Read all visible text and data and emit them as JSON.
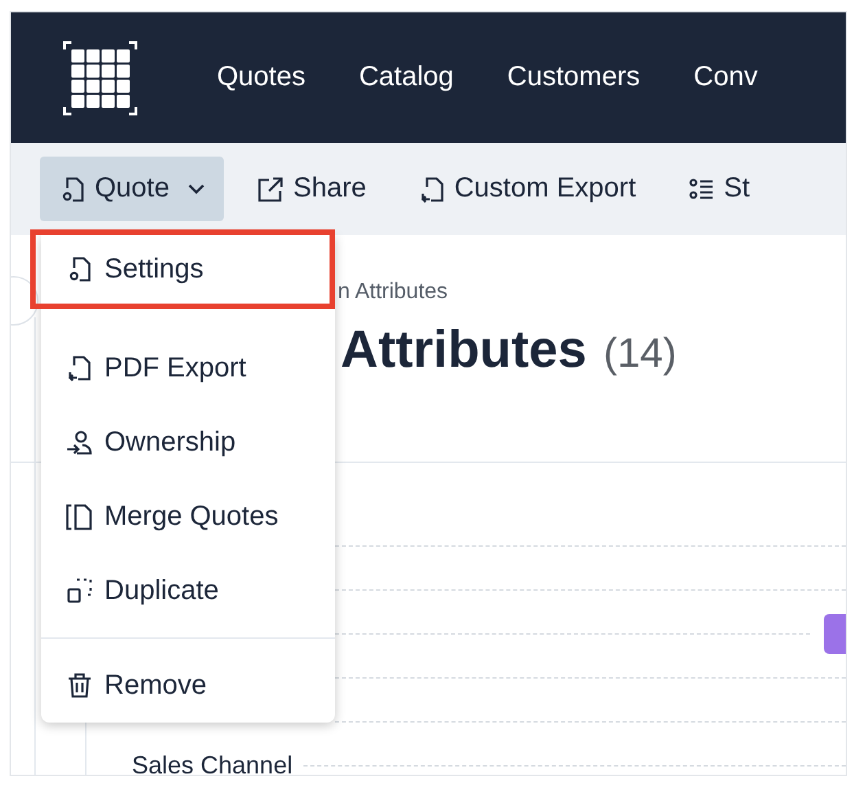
{
  "nav": {
    "items": [
      "Quotes",
      "Catalog",
      "Customers",
      "Conv"
    ]
  },
  "toolbar": {
    "buttons": [
      {
        "label": "Quote",
        "kind": "dropdown",
        "selected": true
      },
      {
        "label": "Share",
        "kind": "plain",
        "selected": false
      },
      {
        "label": "Custom Export",
        "kind": "plain",
        "selected": false
      },
      {
        "label": "St",
        "kind": "plain",
        "selected": false
      }
    ]
  },
  "breadcrumb": "n Attributes",
  "title": {
    "text": "Attributes",
    "count": "(14)"
  },
  "attribute_rows": [
    {
      "label": "Sales Channel"
    }
  ],
  "menu": {
    "items": [
      {
        "label": "Settings",
        "selected": true,
        "divider_before": false
      },
      {
        "label": "PDF Export",
        "selected": false,
        "divider_before": false
      },
      {
        "label": "Ownership",
        "selected": false,
        "divider_before": false
      },
      {
        "label": "Merge Quotes",
        "selected": false,
        "divider_before": false
      },
      {
        "label": "Duplicate",
        "selected": false,
        "divider_before": false
      },
      {
        "label": "Remove",
        "selected": false,
        "divider_before": true
      }
    ]
  }
}
